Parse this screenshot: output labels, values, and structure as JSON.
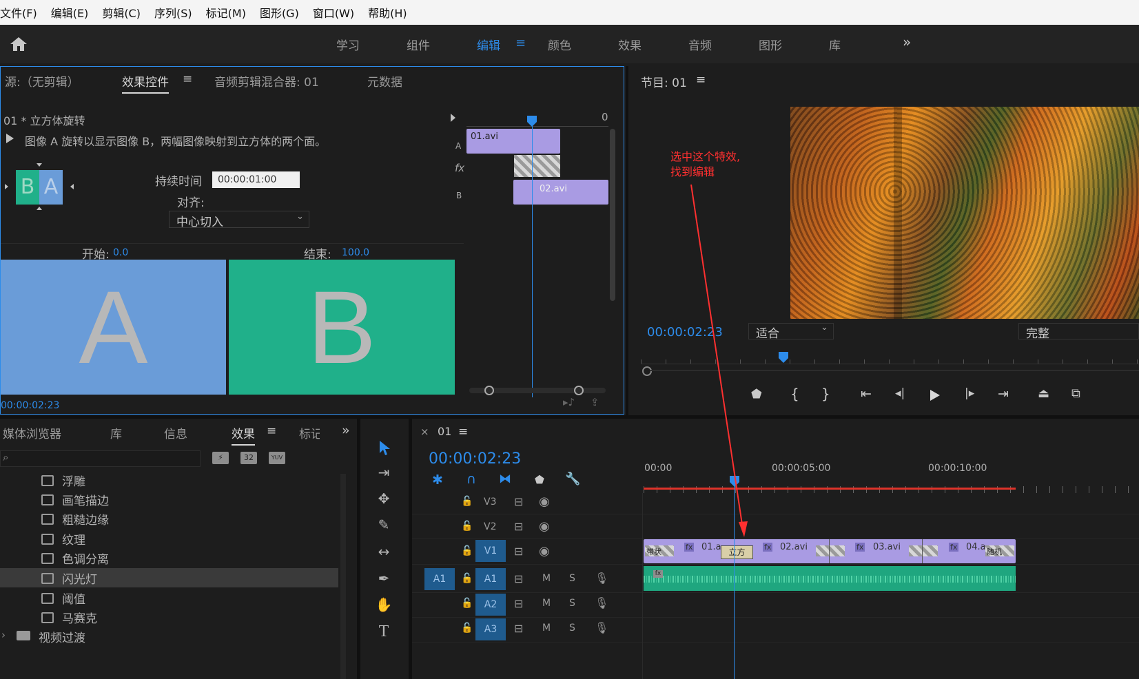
{
  "menu": [
    "文件(F)",
    "编辑(E)",
    "剪辑(C)",
    "序列(S)",
    "标记(M)",
    "图形(G)",
    "窗口(W)",
    "帮助(H)"
  ],
  "workspaces": {
    "learn": "学习",
    "assemble": "组件",
    "edit": "编辑",
    "color": "颜色",
    "effects": "效果",
    "audio": "音频",
    "graphics": "图形",
    "libraries": "库",
    "more": "»"
  },
  "source_panel": {
    "tabs": {
      "source": "源:（无剪辑）",
      "effect_controls": "效果控件",
      "audio_mixer": "音频剪辑混合器: 01",
      "metadata": "元数据"
    },
    "clip_title": "01 * 立方体旋转",
    "description": "图像 A 旋转以显示图像 B，两幅图像映射到立方体的两个面。",
    "preview_b": "B",
    "preview_a": "A",
    "duration_label": "持续时间",
    "duration_value": "00:00:01:00",
    "align_label": "对齐:",
    "align_value": "中心切入",
    "start_label": "开始:",
    "start_value": "0.0",
    "end_label": "结束:",
    "end_value": "100.0",
    "big_a": "A",
    "big_b": "B",
    "timecode": "00:00:02:23",
    "mini_timeline": {
      "ruler_zero": "0",
      "track_a": "A",
      "track_fx": "fx",
      "track_b": "B",
      "clip1": "01.avi",
      "clip2": "02.avi"
    }
  },
  "program_panel": {
    "title": "节目: 01",
    "timecode": "00:00:02:23",
    "fit": "适合",
    "quality": "完整",
    "annotation_line1": "选中这个特效,",
    "annotation_line2": "找到编辑"
  },
  "effects_panel": {
    "tabs": {
      "media_browser": "媒体浏览器",
      "libraries": "库",
      "info": "信息",
      "effects": "效果",
      "markers": "标记",
      "more": "»"
    },
    "search_placeholder": "",
    "buttons": {
      "accel": "⚡",
      "b32": "32",
      "yuv": "YUV"
    },
    "items": [
      "浮雕",
      "画笔描边",
      "粗糙边缘",
      "纹理",
      "色调分离",
      "闪光灯",
      "阈值",
      "马赛克"
    ],
    "folder": "视频过渡"
  },
  "timeline": {
    "close": "×",
    "seq_name": "01",
    "timecode": "00:00:02:23",
    "ruler": [
      "00:00",
      "00:00:05:00",
      "00:00:10:00"
    ],
    "tracks": {
      "v3": "V3",
      "v2": "V2",
      "v1": "V1",
      "a1": "A1",
      "a2": "A2",
      "a3": "A3",
      "a1_src": "A1"
    },
    "mute": "M",
    "solo": "S",
    "clips": {
      "c1": "01.a",
      "t1": "立方",
      "c2": "02.avi",
      "c3": "03.avi",
      "c4": "04.a",
      "t4": "随机",
      "t0": "带状"
    }
  },
  "colors": {
    "accent": "#2d8ceb",
    "clip": "#a99be3",
    "audio": "#1fa67f",
    "preview_a": "#6a9cd8",
    "preview_b": "#20b08a",
    "playhead": "#2d8ceb",
    "annotation": "#ff3030"
  }
}
